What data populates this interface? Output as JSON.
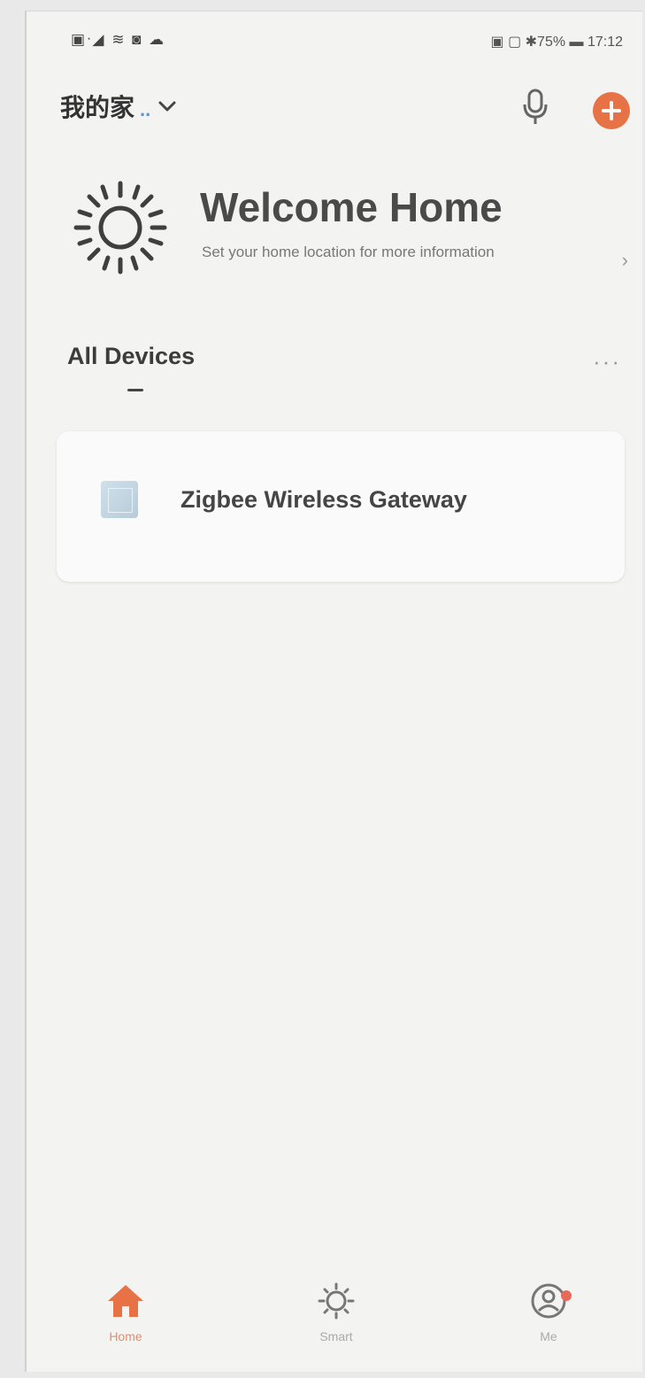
{
  "status_bar": {
    "left_icons": "▣ᐧ◢ ≋ ◙ ☁",
    "right_text": "▣ ▢ ✱75% ▬ 17:12"
  },
  "header": {
    "home_name": "我的家",
    "home_suffix": "..",
    "add_color": "#e67246"
  },
  "welcome": {
    "title": "Welcome Home",
    "subtitle": "Set your home location for more information",
    "arrow": "›"
  },
  "devices_section": {
    "title": "All Devices",
    "more": "···"
  },
  "devices": [
    {
      "name": "Zigbee Wireless Gateway",
      "icon": "gateway-icon"
    }
  ],
  "tabs": [
    {
      "label": "Home",
      "icon": "home-icon",
      "active": true
    },
    {
      "label": "Smart",
      "icon": "sun-icon",
      "active": false
    },
    {
      "label": "Me",
      "icon": "profile-icon",
      "active": false
    }
  ],
  "colors": {
    "accent": "#e67246",
    "background": "#f3f3f2"
  }
}
